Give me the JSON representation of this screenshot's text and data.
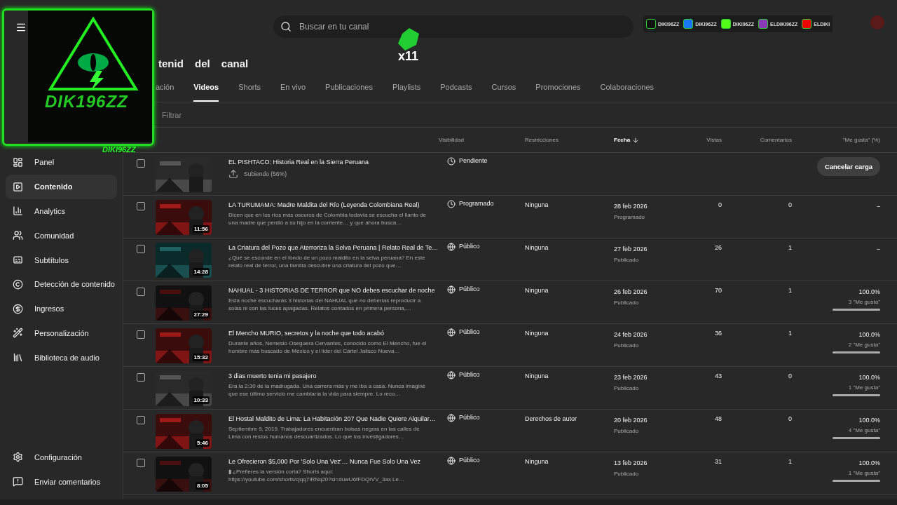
{
  "topbar": {
    "search_placeholder": "Buscar en tu canal",
    "socials": [
      {
        "kind": "tiktok",
        "handle": "DIKI96ZZ"
      },
      {
        "kind": "facebook",
        "handle": "DIKI96ZZ"
      },
      {
        "kind": "kick",
        "handle": "DIKI96ZZ"
      },
      {
        "kind": "instagram",
        "handle": "ELDIKI96ZZ"
      },
      {
        "kind": "youtube",
        "handle": "ELDIKI"
      }
    ]
  },
  "overlay": {
    "logo_text": "DIK196ZZ",
    "logo_caption": "DIKI96ZZ",
    "counter": "x11"
  },
  "sidebar": {
    "items": [
      {
        "label": "Panel",
        "selected": false
      },
      {
        "label": "Contenido",
        "selected": true
      },
      {
        "label": "Analytics",
        "selected": false
      },
      {
        "label": "Comunidad",
        "selected": false
      },
      {
        "label": "Subtítulos",
        "selected": false
      },
      {
        "label": "Detección de contenido",
        "selected": false
      },
      {
        "label": "Ingresos",
        "selected": false
      },
      {
        "label": "Personalización",
        "selected": false
      },
      {
        "label": "Biblioteca de audio",
        "selected": false
      }
    ],
    "footer": [
      "Configuración",
      "Enviar comentarios"
    ]
  },
  "page_title": "tenid del canal",
  "tabs": [
    {
      "label": "ación",
      "selected": false
    },
    {
      "label": "Videos",
      "selected": true
    },
    {
      "label": "Shorts",
      "selected": false
    },
    {
      "label": "En vivo",
      "selected": false
    },
    {
      "label": "Publicaciones",
      "selected": false
    },
    {
      "label": "Playlists",
      "selected": false
    },
    {
      "label": "Podcasts",
      "selected": false
    },
    {
      "label": "Cursos",
      "selected": false
    },
    {
      "label": "Promociones",
      "selected": false
    },
    {
      "label": "Colaboraciones",
      "selected": false
    }
  ],
  "filter_placeholder": "Filtrar",
  "table": {
    "columns": [
      "Visibilidad",
      "Restricciones",
      "Fecha",
      "Vistas",
      "Comentarios",
      "\"Me gusta\" (%)"
    ],
    "rows": [
      {
        "kind": "uploading",
        "checked": false,
        "title": "EL PISHTACO: Historia Real en la Sierra Peruana",
        "status": "Subiendo (56%)",
        "visibility": "Pendiente",
        "action": "Cancelar carga"
      },
      {
        "kind": "scheduled",
        "checked": false,
        "title": "LA TURUMAMA: Madre Maldita del Río (Leyenda Colombiana Real)",
        "description": "Dicen que en los ríos más oscuros de Colombia todavía se escucha el llanto de una madre que perdió a su hijo en la corriente… y que ahora busca…",
        "duration": "11:56",
        "visibility": "Programado",
        "restrictions": "Ninguna",
        "date": "28 feb 2026",
        "date_status": "Programado",
        "views": "0",
        "comments": "0",
        "likes": "–"
      },
      {
        "kind": "published",
        "checked": false,
        "title": "La Criatura del Pozo que Aterroriza la Selva Peruana | Relato Real de Te…",
        "description": "¿Qué se esconde en el fondo de un pozo maldito en la selva peruana? En este relato real de terror, una familia descubre una criatura del pozo que…",
        "duration": "14:28",
        "visibility": "Público",
        "restrictions": "Ninguna",
        "date": "27 feb 2026",
        "date_status": "Publicado",
        "views": "26",
        "comments": "1",
        "likes": "–"
      },
      {
        "kind": "published",
        "checked": false,
        "title": "NAHUAL - 3 HISTORIAS DE TERROR que NO debes escuchar de noche",
        "description": "Esta noche escucharás 3 historias del NAHUAL que no deberías reproducir a solas ni con las luces apagadas. Relatos contados en primera persona,…",
        "duration": "27:29",
        "visibility": "Público",
        "restrictions": "Ninguna",
        "date": "26 feb 2026",
        "date_status": "Publicado",
        "views": "70",
        "comments": "1",
        "likes": "100.0%",
        "like_count": "3 \"Me gusta\"",
        "level": 1
      },
      {
        "kind": "published",
        "checked": false,
        "title": "El Mencho MURIO, secretos y la noche que todo acabó",
        "description": "Durante años, Nemesio Oseguera Cervantes, conocido como El Mencho, fue el hombre más buscado de México y el líder del Cártel Jalisco Nueva…",
        "duration": "15:32",
        "visibility": "Público",
        "restrictions": "Ninguna",
        "date": "24 feb 2026",
        "date_status": "Publicado",
        "views": "36",
        "comments": "1",
        "likes": "100.0%",
        "like_count": "2 \"Me gusta\"",
        "level": 1
      },
      {
        "kind": "published",
        "checked": false,
        "title": "3 dias muerto tenia mi pasajero",
        "description": "Era la 2:30 de la madrugada. Una carrera más y me iba a casa. Nunca imaginé que ese último servicio me cambiaría la vida para siempre. Lo reco…",
        "duration": "10:33",
        "visibility": "Público",
        "restrictions": "Ninguna",
        "date": "23 feb 2026",
        "date_status": "Publicado",
        "views": "43",
        "comments": "0",
        "likes": "100.0%",
        "like_count": "1 \"Me gusta\"",
        "level": 1
      },
      {
        "kind": "published",
        "checked": false,
        "title": "El Hostal Maldito de Lima: La Habitación 207 Que Nadie Quiere Alquilar…",
        "description": "Septiembre 9, 2019. Trabajadores encuentran bolsas negras en las calles de Lima con restos humanos descuartizados. Lo que los investigadores…",
        "duration": "5:46",
        "visibility": "Público",
        "restrictions": "Derechos de autor",
        "date": "20 feb 2026",
        "date_status": "Publicado",
        "views": "48",
        "comments": "0",
        "likes": "100.0%",
        "like_count": "4 \"Me gusta\"",
        "level": 1
      },
      {
        "kind": "published",
        "checked": false,
        "title": "Le Ofrecieron $5,000 Por 'Solo Una Vez'… Nunca Fue Solo Una Vez",
        "description": "▮ ¿Prefieres la versión corta? Shorts aquí: https://youtube.com/shorts/cjqq7IRNq20?si=duwU6fFDQrVV_3ax Le…",
        "duration": "8:05",
        "visibility": "Público",
        "restrictions": "Ninguna",
        "date": "13 feb 2026",
        "date_status": "Publicado",
        "views": "31",
        "comments": "1",
        "likes": "100.0%",
        "like_count": "1 \"Me gusta\"",
        "level": 1
      }
    ]
  }
}
